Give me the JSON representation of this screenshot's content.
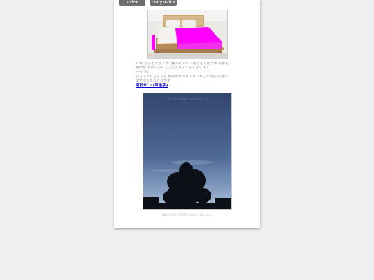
{
  "nav": {
    "index_label": "index",
    "diary_index_label": "diary index"
  },
  "bed_photo": {
    "alt": "bed photo",
    "accent": "#ff00ff"
  },
  "caption": {
    "lines": [
      "ﾀﾞﾒﾀﾞのふとんが１ｍで眠れない人 - 見ちとのほうが 毛布を",
      "掛布が 斜めておくとふとんがずれなくなります",
      "ﾄｰｰﾝ!!!/",
      "ひさはまだちょっと 時間がありますが・あしたから は寝い",
      "ますほしたらさらです"
    ],
    "link_text": "南西ﾅﾋﾞ・(写進字)"
  },
  "sky_photo": {
    "watermark": "http://10103004.searchbs.org"
  },
  "footer": {
    "url": "http://10103004.searchbs.org"
  }
}
